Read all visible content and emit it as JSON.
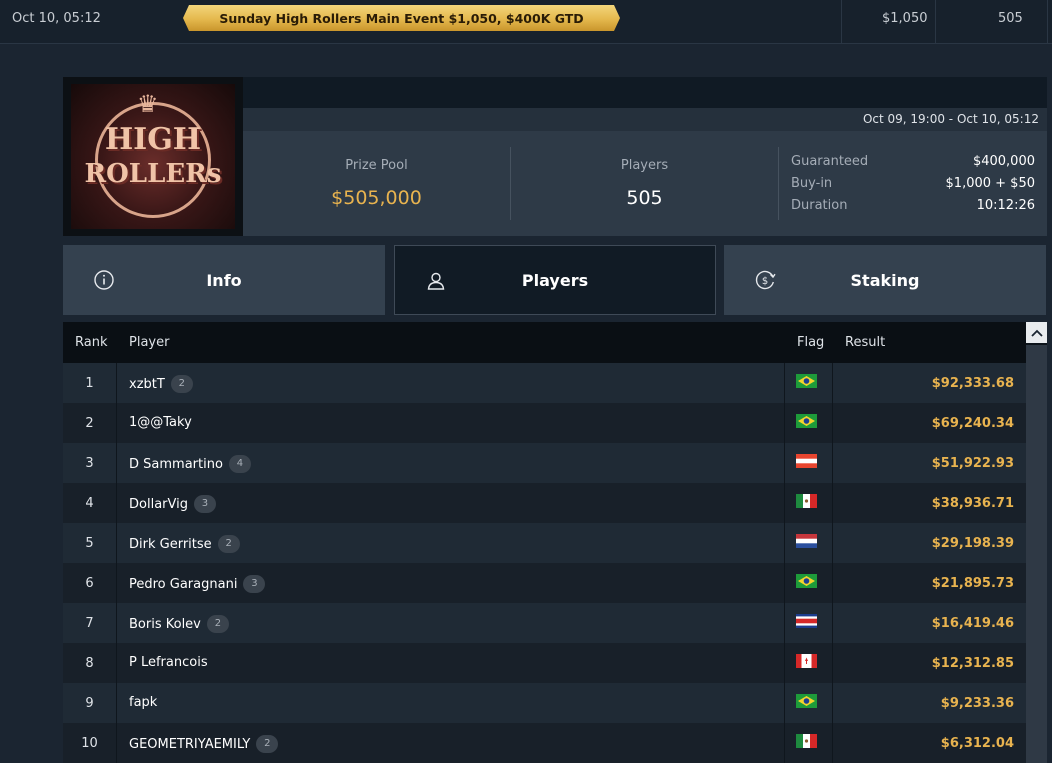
{
  "top_row": {
    "date": "Oct 10, 05:12",
    "banner": "Sunday High Rollers Main Event $1,050, $400K GTD",
    "buyin": "$1,050",
    "entries": "505"
  },
  "logo": {
    "line1": "HIGH",
    "line2": "ROLLERs"
  },
  "header": {
    "date_range": "Oct 09, 19:00 - Oct 10, 05:12",
    "prize_pool_label": "Prize Pool",
    "prize_pool_value": "$505,000",
    "players_label": "Players",
    "players_value": "505",
    "details": [
      {
        "label": "Guaranteed",
        "value": "$400,000"
      },
      {
        "label": "Buy-in",
        "value": "$1,000 + $50"
      },
      {
        "label": "Duration",
        "value": "10:12:26"
      }
    ]
  },
  "tabs": [
    {
      "label": "Info",
      "icon": "info-icon"
    },
    {
      "label": "Players",
      "icon": "user-icon",
      "active": true
    },
    {
      "label": "Staking",
      "icon": "dollar-coin-icon"
    }
  ],
  "table": {
    "headers": {
      "rank": "Rank",
      "player": "Player",
      "flag": "Flag",
      "result": "Result"
    },
    "rows": [
      {
        "rank": "1",
        "player": "xzbtT",
        "badge": "2",
        "flag": "brazil",
        "result": "$92,333.68"
      },
      {
        "rank": "2",
        "player": "1@@Taky",
        "badge": "",
        "flag": "brazil",
        "result": "$69,240.34"
      },
      {
        "rank": "3",
        "player": "D Sammartino",
        "badge": "4",
        "flag": "austria",
        "result": "$51,922.93"
      },
      {
        "rank": "4",
        "player": "DollarVig",
        "badge": "3",
        "flag": "mexico",
        "result": "$38,936.71"
      },
      {
        "rank": "5",
        "player": "Dirk Gerritse",
        "badge": "2",
        "flag": "netherlands",
        "result": "$29,198.39"
      },
      {
        "rank": "6",
        "player": "Pedro Garagnani",
        "badge": "3",
        "flag": "brazil",
        "result": "$21,895.73"
      },
      {
        "rank": "7",
        "player": "Boris Kolev",
        "badge": "2",
        "flag": "costa-rica",
        "result": "$16,419.46"
      },
      {
        "rank": "8",
        "player": "P Lefrancois",
        "badge": "",
        "flag": "canada",
        "result": "$12,312.85"
      },
      {
        "rank": "9",
        "player": "fapk",
        "badge": "",
        "flag": "brazil",
        "result": "$9,233.36"
      },
      {
        "rank": "10",
        "player": "GEOMETRIYAEMILY",
        "badge": "2",
        "flag": "mexico",
        "result": "$6,312.04"
      }
    ]
  },
  "colors": {
    "accent_gold": "#e8b34f",
    "background": "#1b2531",
    "active_tab": "#111b25"
  }
}
